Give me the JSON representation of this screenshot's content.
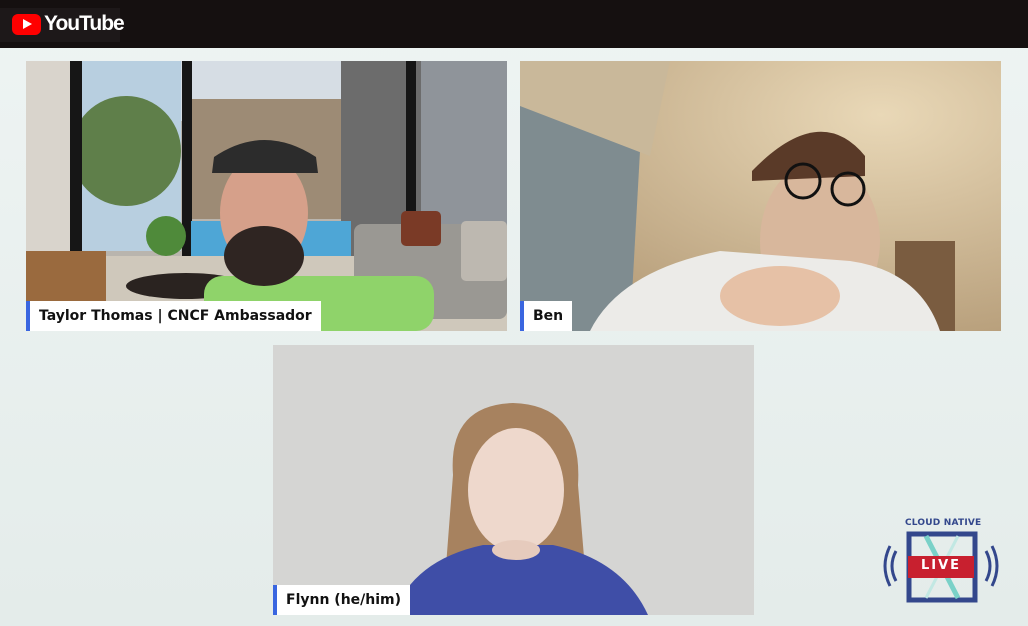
{
  "app": {
    "brand": "YouTube",
    "logo_icon": "youtube-play-icon",
    "accent_color": "#ff0000"
  },
  "participants": [
    {
      "name": "Taylor Thomas | CNCF Ambassador",
      "tag_color": "#3a66e0"
    },
    {
      "name": "Ben",
      "tag_color": "#3a66e0"
    },
    {
      "name": "Flynn (he/him)",
      "tag_color": "#3a66e0"
    }
  ],
  "badge": {
    "title": "CLOUD NATIVE",
    "label": "LIVE",
    "colors": {
      "blue": "#33478c",
      "red": "#c8202f",
      "teal": "#7ad1c8"
    }
  }
}
